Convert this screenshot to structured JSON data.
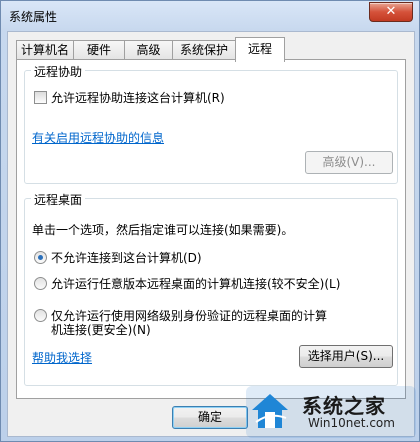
{
  "window": {
    "title": "系统属性",
    "close_glyph": "✕"
  },
  "tabs": [
    {
      "label": "计算机名",
      "active": false
    },
    {
      "label": "硬件",
      "active": false
    },
    {
      "label": "高级",
      "active": false
    },
    {
      "label": "系统保护",
      "active": false
    },
    {
      "label": "远程",
      "active": true
    }
  ],
  "remote_assistance": {
    "group_title": "远程协助",
    "checkbox_label": "允许远程协助连接这台计算机(R)",
    "checkbox_checked": false,
    "info_link": "有关启用远程协助的信息",
    "advanced_button": "高级(V)..."
  },
  "remote_desktop": {
    "group_title": "远程桌面",
    "instruction": "单击一个选项，然后指定谁可以连接(如果需要)。",
    "options": [
      {
        "label": "不允许连接到这台计算机(D)",
        "checked": true
      },
      {
        "label": "允许运行任意版本远程桌面的计算机连接(较不安全)(L)",
        "checked": false
      },
      {
        "label_line1": "仅允许运行使用网络级别身份验证的远程桌面的计算",
        "label_line2": "机连接(更安全)(N)",
        "checked": false
      }
    ],
    "help_link": "帮助我选择",
    "select_users_button": "选择用户(S)..."
  },
  "footer": {
    "ok_button": "确定"
  },
  "watermark": {
    "text": "系统之家",
    "url": "Win10net.com"
  }
}
